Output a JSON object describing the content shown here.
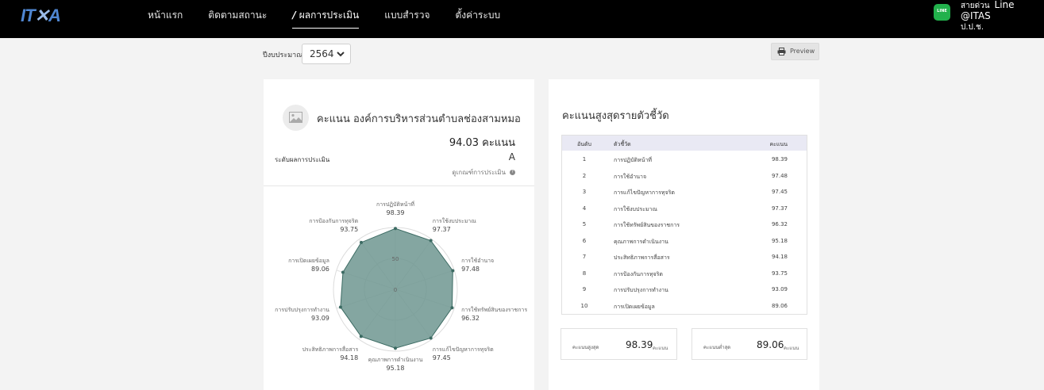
{
  "header": {
    "logo_main": "IT",
    "logo_accent": "A",
    "nav": [
      "หน้าแรก",
      "ติดตามสถานะ",
      "ผลการประเมิน",
      "แบบสำรวจ",
      "ตั้งค่าระบบ"
    ],
    "active_slash": "/",
    "line_badge": "LINE",
    "hotline_label": "สายด่วน",
    "hotline_value": "Line @ITAS",
    "hotline_org": "ป.ป.ช."
  },
  "filters": {
    "year_label": "ปีงบประมาณ",
    "year_value": "2564"
  },
  "preview_label": "Preview",
  "summary": {
    "title": "คะแนน องค์การบริหารส่วนตำบลช่องสามหมอ",
    "score": "94.03 คะแนน",
    "level_label": "ระดับผลการประเมิน",
    "grade": "A",
    "criteria_link": "ดูเกณฑ์การประเมิน",
    "criteria_icon": "?"
  },
  "chart_data": {
    "type": "radar",
    "rlim": [
      0,
      100
    ],
    "scale_ticks": [
      "0",
      "50"
    ],
    "axes": [
      {
        "label": "การปฏิบัติหน้าที่",
        "value": 98.39
      },
      {
        "label": "การใช้งบประมาณ",
        "value": 97.37
      },
      {
        "label": "การใช้อำนาจ",
        "value": 97.48
      },
      {
        "label": "การใช้ทรัพย์สินของราชการ",
        "value": 96.32
      },
      {
        "label": "การแก้ไขปัญหาการทุจริต",
        "value": 97.45
      },
      {
        "label": "คุณภาพการดำเนินงาน",
        "value": 95.18
      },
      {
        "label": "ประสิทธิภาพการสื่อสาร",
        "value": 94.18
      },
      {
        "label": "การปรับปรุงการทำงาน",
        "value": 93.09
      },
      {
        "label": "การเปิดเผยข้อมูล",
        "value": 89.06
      },
      {
        "label": "การป้องกันการทุจริต",
        "value": 93.75
      }
    ],
    "fill_color": "#6f9791",
    "stroke_color": "#3c6b63"
  },
  "ranking": {
    "title": "คะแนนสูงสุดรายตัวชี้วัด",
    "headers": [
      "อันดับ",
      "ตัวชี้วัด",
      "คะแนน"
    ],
    "rows": [
      [
        "1",
        "การปฏิบัติหน้าที่",
        "98.39"
      ],
      [
        "2",
        "การใช้อำนาจ",
        "97.48"
      ],
      [
        "3",
        "การแก้ไขปัญหาการทุจริต",
        "97.45"
      ],
      [
        "4",
        "การใช้งบประมาณ",
        "97.37"
      ],
      [
        "5",
        "การใช้ทรัพย์สินของราชการ",
        "96.32"
      ],
      [
        "6",
        "คุณภาพการดำเนินงาน",
        "95.18"
      ],
      [
        "7",
        "ประสิทธิภาพการสื่อสาร",
        "94.18"
      ],
      [
        "8",
        "การป้องกันการทุจริต",
        "93.75"
      ],
      [
        "9",
        "การปรับปรุงการทำงาน",
        "93.09"
      ],
      [
        "10",
        "การเปิดเผยข้อมูล",
        "89.06"
      ]
    ]
  },
  "stats": {
    "max_label": "คะแนนสูงสุด",
    "max_value": "98.39",
    "max_unit": "คะแนน",
    "min_label": "คะแนนต่ำสุด",
    "min_value": "89.06",
    "min_unit": "คะแนน"
  }
}
